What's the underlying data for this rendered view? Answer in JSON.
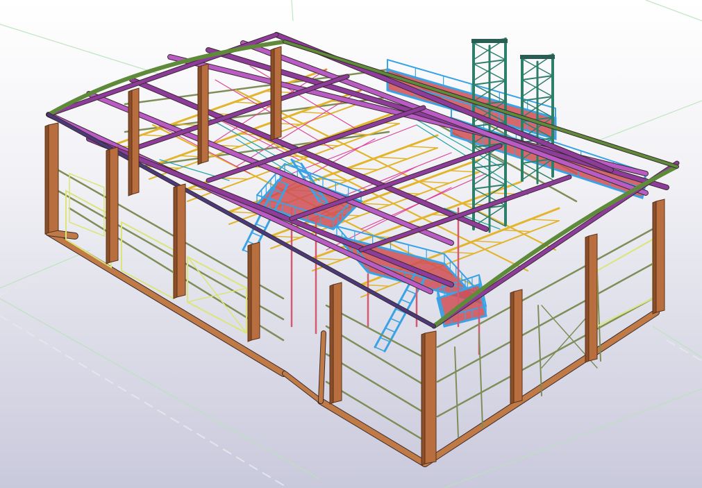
{
  "viewport": {
    "background_top": "#ffffff",
    "background_bottom": "#c9c9dc",
    "view": "3d-isometric"
  },
  "model": {
    "type": "steel-frame-building",
    "member_colors": {
      "column": "#b86e3e",
      "column_dark": "#8a4f28",
      "base_beam": "#c07a45",
      "roof_rafter": "#8e3c9a",
      "roof_rafter_light": "#b85cc4",
      "edge_beam": "#5e8a3a",
      "wall_girt": "#7f8e58",
      "wall_bracing": "#dbe57a",
      "roof_truss": "#e3b52c",
      "roof_bracing": "#e0449a",
      "platform": "#3aa3e6",
      "platform_beam": "#cf4f55",
      "tower": "#2e7f6a",
      "grid_line": "#b9e3b9",
      "ground_line": "#dfe2e8"
    }
  }
}
